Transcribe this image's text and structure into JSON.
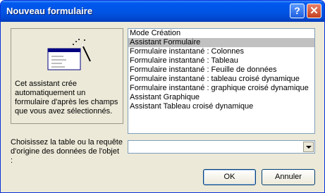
{
  "window": {
    "title": "Nouveau formulaire",
    "help_glyph": "?",
    "close_glyph": "✕"
  },
  "wizard": {
    "description": "Cet assistant crée automatiquement un formulaire d'après les champs que vous avez sélectionnés."
  },
  "list": {
    "items": [
      "Mode Création",
      "Assistant Formulaire",
      "Formulaire instantané : Colonnes",
      "Formulaire instantané : Tableau",
      "Formulaire instantané : Feuille de données",
      "Formulaire instantané : tableau croisé dynamique",
      "Formulaire instantané : graphique croisé dynamique",
      "Assistant Graphique",
      "Assistant Tableau croisé dynamique"
    ],
    "selected_index": 1
  },
  "source": {
    "prompt": "Choisissez la table ou la requête d'origine des données de l'objet :",
    "value": ""
  },
  "buttons": {
    "ok": "OK",
    "cancel": "Annuler"
  }
}
